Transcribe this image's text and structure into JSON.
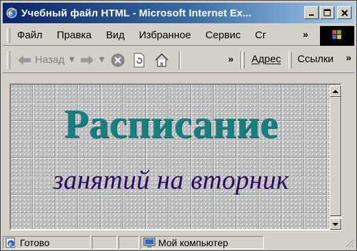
{
  "window": {
    "title": "Учебный файл HTML - Microsoft Internet Ex...",
    "buttons": {
      "minimize": "_",
      "maximize": "□",
      "close": "×"
    }
  },
  "menu": {
    "items": [
      "Файл",
      "Правка",
      "Вид",
      "Избранное",
      "Сервис",
      "Сг"
    ],
    "more": "»"
  },
  "toolbar": {
    "back_label": "Назад",
    "more": "»",
    "address_label": "Адрес",
    "links_label": "Ссылки",
    "links_more": "»"
  },
  "page": {
    "heading": "Расписание",
    "subheading": "занятий на вторник"
  },
  "status": {
    "text": "Готово",
    "zone": "Мой компьютер"
  },
  "colors": {
    "heading": "#158080",
    "subheading": "#2e0a66",
    "titlebar_start": "#0a246a",
    "titlebar_end": "#a6caf0"
  }
}
